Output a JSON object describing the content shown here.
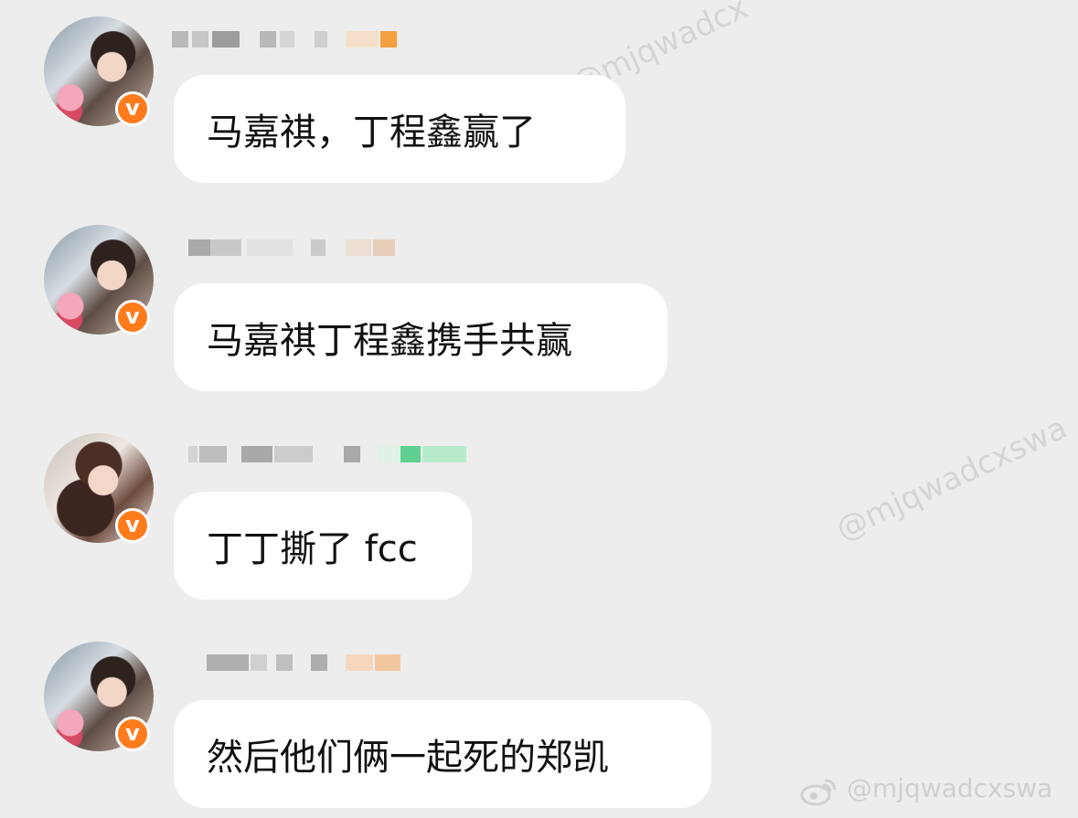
{
  "messages": [
    {
      "avatar_icon": "profile-photo",
      "verified_icon": "verified-badge-icon",
      "verified_mark": "v",
      "text": "马嘉祺，丁程鑫赢了"
    },
    {
      "avatar_icon": "profile-photo",
      "verified_icon": "verified-badge-icon",
      "verified_mark": "v",
      "text": "马嘉祺丁程鑫携手共赢"
    },
    {
      "avatar_icon": "profile-photo",
      "verified_icon": "verified-badge-icon",
      "verified_mark": "v",
      "text": "丁丁撕了 fcc"
    },
    {
      "avatar_icon": "profile-photo",
      "verified_icon": "verified-badge-icon",
      "verified_mark": "v",
      "text": "然后他们俩一起死的郑凯"
    }
  ],
  "watermarks": {
    "diagonal_1": "@mjqwadcx",
    "diagonal_2": "@mjqwadcxswa",
    "footer": "@mjqwadcxswa",
    "footer_icon": "weibo-logo-icon"
  },
  "colors": {
    "background": "#ededed",
    "bubble": "#ffffff",
    "verified_badge": "#ff7b1c",
    "text": "#111111"
  }
}
